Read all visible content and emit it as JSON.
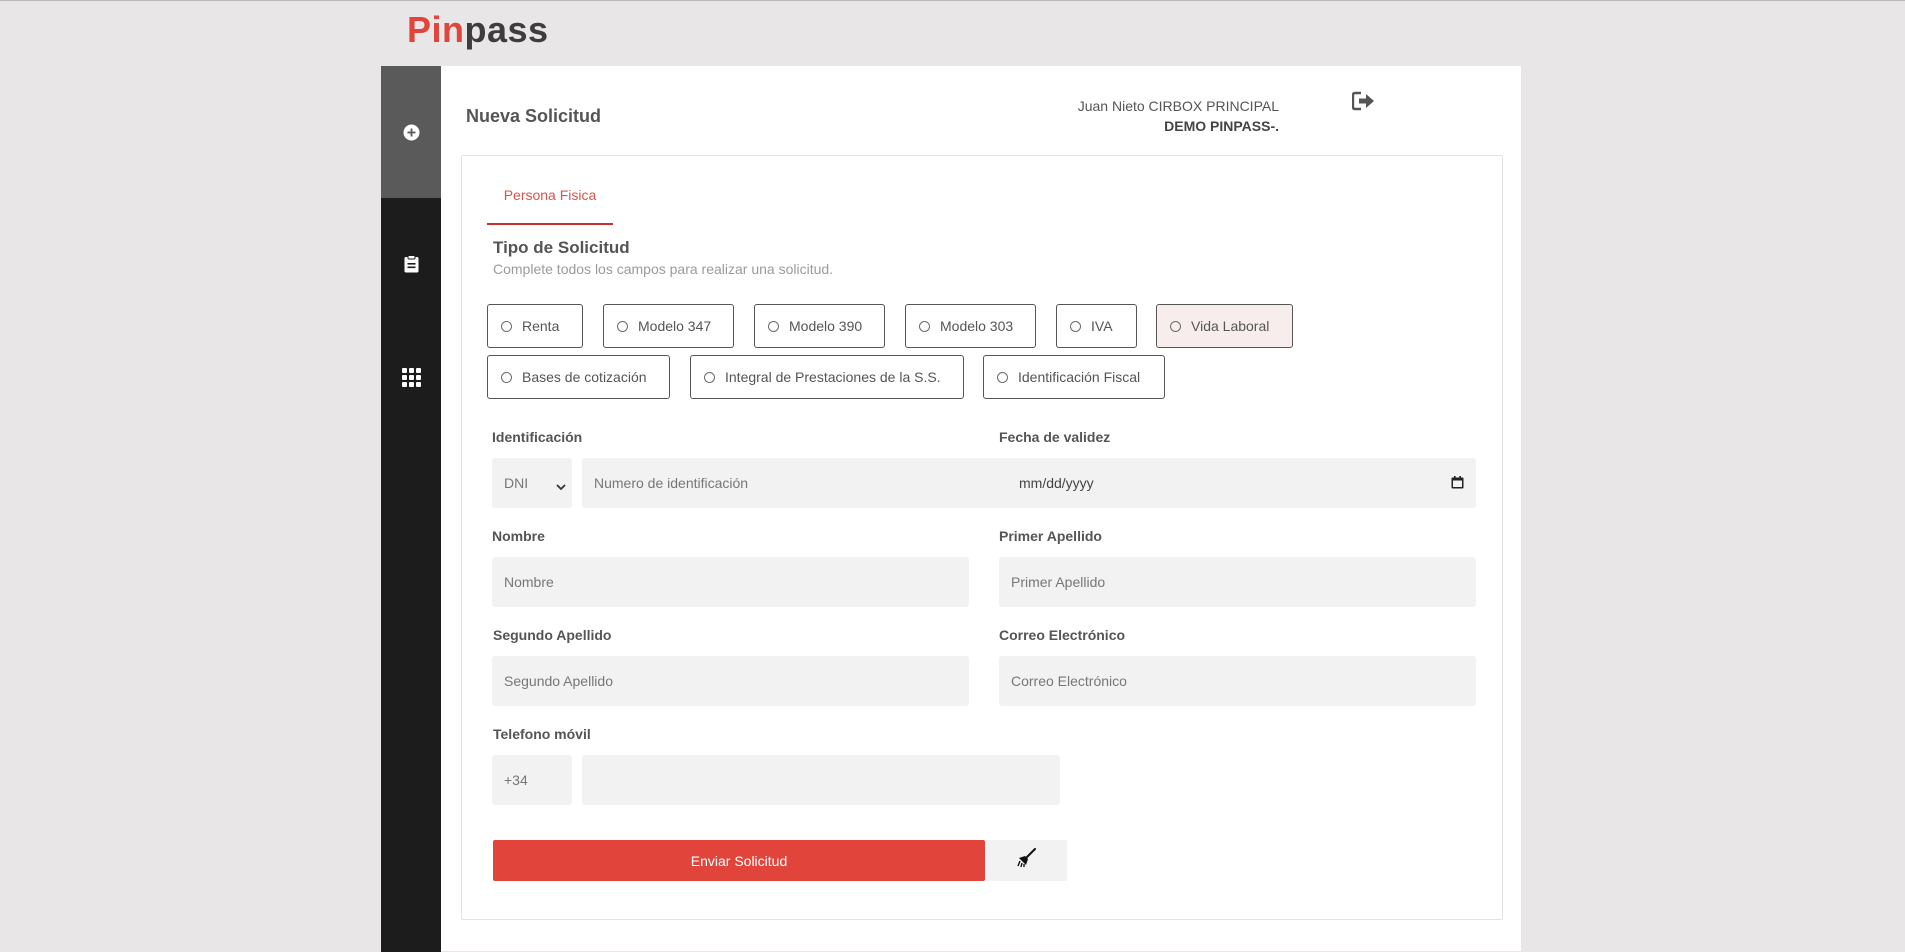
{
  "brand": {
    "logo_red": "Pin",
    "logo_dark": "pass",
    "accent": "#e0443b"
  },
  "sidebar": {
    "items": [
      {
        "icon": "plus-circle-icon",
        "active": true
      },
      {
        "icon": "clipboard-icon",
        "active": false
      },
      {
        "icon": "apps-grid-icon",
        "active": false
      }
    ]
  },
  "header": {
    "title": "Nueva Solicitud",
    "user_line": "Juan Nieto CIRBOX PRINCIPAL",
    "company": "DEMO PINPASS-.",
    "logout_icon": "sign-out-icon"
  },
  "tab": {
    "label": "Persona Fisica"
  },
  "section": {
    "title": "Tipo de Solicitud",
    "subtitle": "Complete todos los campos para realizar una solicitud."
  },
  "request_types": [
    {
      "label": "Renta",
      "selected": false
    },
    {
      "label": "Modelo 347",
      "selected": false
    },
    {
      "label": "Modelo 390",
      "selected": false
    },
    {
      "label": "Modelo 303",
      "selected": false
    },
    {
      "label": "IVA",
      "selected": false
    },
    {
      "label": "Vida Laboral",
      "selected": true
    },
    {
      "label": "Bases de cotización",
      "selected": false
    },
    {
      "label": "Integral de Prestaciones de la S.S.",
      "selected": false
    },
    {
      "label": "Identificación Fiscal",
      "selected": false
    }
  ],
  "form": {
    "identificacion": {
      "label": "Identificación",
      "doc_type": "DNI",
      "placeholder": "Numero de identificación"
    },
    "fecha": {
      "label": "Fecha de validez",
      "placeholder": "mm/dd/yyyy"
    },
    "nombre": {
      "label": "Nombre",
      "placeholder": "Nombre"
    },
    "primer_apellido": {
      "label": "Primer Apellido",
      "placeholder": "Primer Apellido"
    },
    "segundo_apellido": {
      "label": "Segundo Apellido",
      "placeholder": "Segundo Apellido"
    },
    "correo": {
      "label": "Correo Electrónico",
      "placeholder": "Correo Electrónico"
    },
    "telefono": {
      "label": "Telefono móvil",
      "prefix": "+34",
      "value": ""
    }
  },
  "actions": {
    "submit_label": "Enviar Solicitud",
    "clear_icon": "broom-icon"
  }
}
